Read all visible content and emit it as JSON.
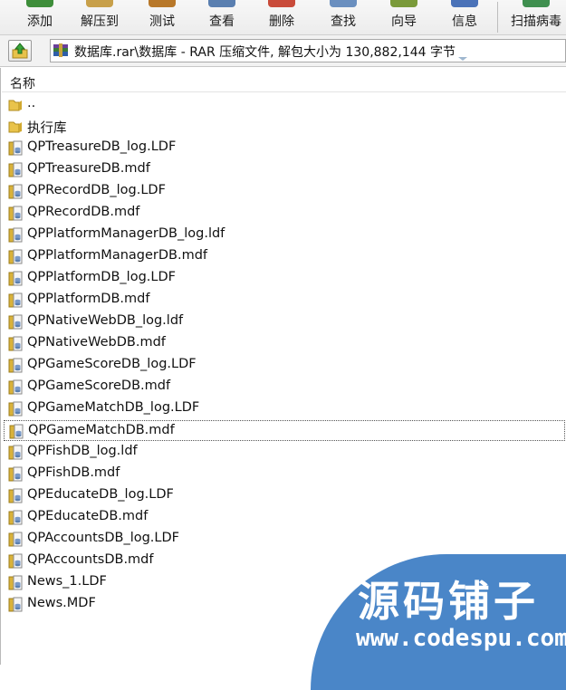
{
  "toolbar": {
    "buttons": [
      {
        "label": "添加",
        "color": "#3e8e3a"
      },
      {
        "label": "解压到",
        "color": "#c8a04a"
      },
      {
        "label": "测试",
        "color": "#b8782a"
      },
      {
        "label": "查看",
        "color": "#5a7fb0"
      },
      {
        "label": "删除",
        "color": "#c94b3a"
      },
      {
        "label": "查找",
        "color": "#6a8fbf"
      },
      {
        "label": "向导",
        "color": "#7a9a3a"
      },
      {
        "label": "信息",
        "color": "#4a72b8"
      },
      {
        "label": "扫描病毒",
        "color": "#3f8f4f"
      }
    ]
  },
  "address": {
    "path": "数据库.rar\\数据库 - RAR 压缩文件, 解包大小为 130,882,144 字节"
  },
  "list": {
    "column_name": "名称",
    "items": [
      {
        "name": "..",
        "type": "folder"
      },
      {
        "name": "执行库",
        "type": "folder"
      },
      {
        "name": "QPTreasureDB_log.LDF",
        "type": "db"
      },
      {
        "name": "QPTreasureDB.mdf",
        "type": "db"
      },
      {
        "name": "QPRecordDB_log.LDF",
        "type": "db"
      },
      {
        "name": "QPRecordDB.mdf",
        "type": "db"
      },
      {
        "name": "QPPlatformManagerDB_log.ldf",
        "type": "db"
      },
      {
        "name": "QPPlatformManagerDB.mdf",
        "type": "db"
      },
      {
        "name": "QPPlatformDB_log.LDF",
        "type": "db"
      },
      {
        "name": "QPPlatformDB.mdf",
        "type": "db"
      },
      {
        "name": "QPNativeWebDB_log.ldf",
        "type": "db"
      },
      {
        "name": "QPNativeWebDB.mdf",
        "type": "db"
      },
      {
        "name": "QPGameScoreDB_log.LDF",
        "type": "db"
      },
      {
        "name": "QPGameScoreDB.mdf",
        "type": "db"
      },
      {
        "name": "QPGameMatchDB_log.LDF",
        "type": "db"
      },
      {
        "name": "QPGameMatchDB.mdf",
        "type": "db",
        "focused": true
      },
      {
        "name": "QPFishDB_log.ldf",
        "type": "db"
      },
      {
        "name": "QPFishDB.mdf",
        "type": "db"
      },
      {
        "name": "QPEducateDB_log.LDF",
        "type": "db"
      },
      {
        "name": "QPEducateDB.mdf",
        "type": "db"
      },
      {
        "name": "QPAccountsDB_log.LDF",
        "type": "db"
      },
      {
        "name": "QPAccountsDB.mdf",
        "type": "db"
      },
      {
        "name": "News_1.LDF",
        "type": "db"
      },
      {
        "name": "News.MDF",
        "type": "db"
      }
    ]
  },
  "watermark": {
    "title": "源码铺子",
    "url": "www.codespu.com",
    "color": "#4a86c8"
  }
}
